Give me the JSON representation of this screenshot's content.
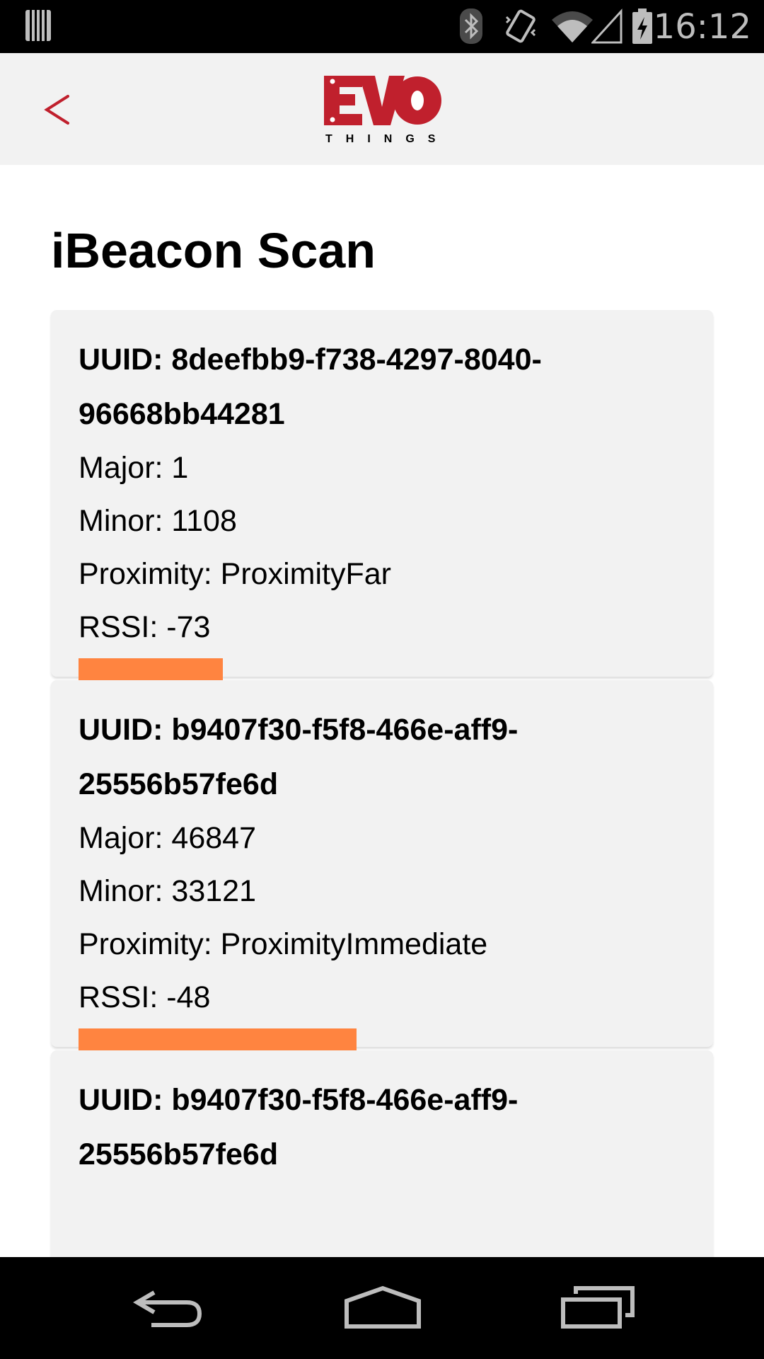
{
  "status_bar": {
    "time": "16:12",
    "icons": [
      "storage-icon",
      "bluetooth-icon",
      "vibrate-icon",
      "wifi-icon",
      "cell-signal-icon",
      "battery-charging-icon"
    ]
  },
  "header": {
    "logo_text": "EVO",
    "logo_subtext": "THINGS",
    "back_icon": "chevron-left-icon"
  },
  "page": {
    "title": "iBeacon Scan"
  },
  "colors": {
    "accent": "#c0202d",
    "rssi_bar": "#ff8440",
    "card_bg": "#f2f2f2",
    "header_bg": "#f2f2f2"
  },
  "beacons": [
    {
      "uuid": "UUID: 8deefbb9-f738-4297-8040-96668bb44281",
      "major": "Major: 1",
      "minor": "Minor: 1108",
      "proximity": "Proximity: ProximityFar",
      "rssi": "RSSI: -73",
      "rssi_value": -73
    },
    {
      "uuid": "UUID: b9407f30-f5f8-466e-aff9-25556b57fe6d",
      "major": "Major: 46847",
      "minor": "Minor: 33121",
      "proximity": "Proximity: ProximityImmediate",
      "rssi": "RSSI: -48",
      "rssi_value": -48
    },
    {
      "uuid": "UUID: b9407f30-f5f8-466e-aff9-25556b57fe6d"
    }
  ],
  "nav_bar": {
    "icons": [
      "back-nav-icon",
      "home-nav-icon",
      "recents-nav-icon"
    ]
  }
}
